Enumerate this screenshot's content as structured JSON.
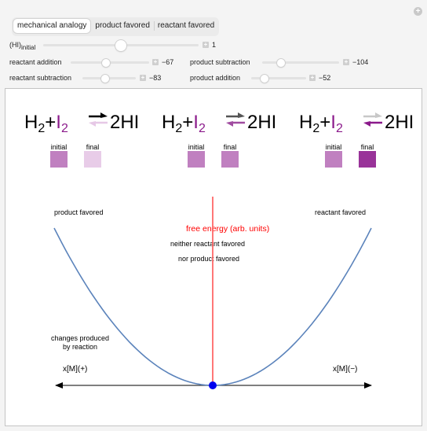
{
  "header": {
    "corner_icon": "plus-circle-icon",
    "tabs": [
      {
        "label": "mechanical analogy",
        "active": true
      },
      {
        "label": "product favored",
        "active": false
      },
      {
        "label": "reactant favored",
        "active": false
      }
    ]
  },
  "controls": {
    "hi_initial": {
      "label_main": "(HI)",
      "label_sub": "initial",
      "value": "1",
      "fraction": 0.5
    },
    "reactant_addition": {
      "label": "reactant addition",
      "value": "−67",
      "fraction": 0.45
    },
    "reactant_subtraction": {
      "label": "reactant subtraction",
      "value": "−83",
      "fraction": 0.43
    },
    "product_subtraction": {
      "label": "product subtraction",
      "value": "−104",
      "fraction": 0.24
    },
    "product_addition": {
      "label": "product addition",
      "value": "−52",
      "fraction": 0.24
    }
  },
  "reactions": [
    {
      "h": "H",
      "h_sub": "2",
      "plus": "+",
      "i": "I",
      "i_sub": "2",
      "product": "2HI",
      "forward_color": "#000000",
      "reverse_color": "#e6c8e6",
      "initial_label": "initial",
      "final_label": "final",
      "initial_color": "#c080c0",
      "final_color": "#e8cce8"
    },
    {
      "h": "H",
      "h_sub": "2",
      "plus": "+",
      "i": "I",
      "i_sub": "2",
      "product": "2HI",
      "forward_color": "#555555",
      "reverse_color": "#a04ca0",
      "initial_label": "initial",
      "final_label": "final",
      "initial_color": "#c080c0",
      "final_color": "#c080c0"
    },
    {
      "h": "H",
      "h_sub": "2",
      "plus": "+",
      "i": "I",
      "i_sub": "2",
      "product": "2HI",
      "forward_color": "#c8c8c8",
      "reverse_color": "#8b1a8b",
      "initial_label": "initial",
      "final_label": "final",
      "initial_color": "#c080c0",
      "final_color": "#993399"
    }
  ],
  "iodine_color": "#8b1a8b",
  "graph": {
    "left_label": "product favored",
    "right_label": "reactant favored",
    "axis_label": "free energy (arb. units)",
    "center_line1": "neither reactant favored",
    "center_line2": "nor product favored",
    "changes_line1": "changes produced",
    "changes_line2": "by reaction",
    "x_left": "x[M](+)",
    "x_right": "x[M](−)",
    "curve_color": "#5b83bb",
    "axis_color": "#ff0000",
    "ball_color": "#0000ee",
    "ball_position": 0
  }
}
